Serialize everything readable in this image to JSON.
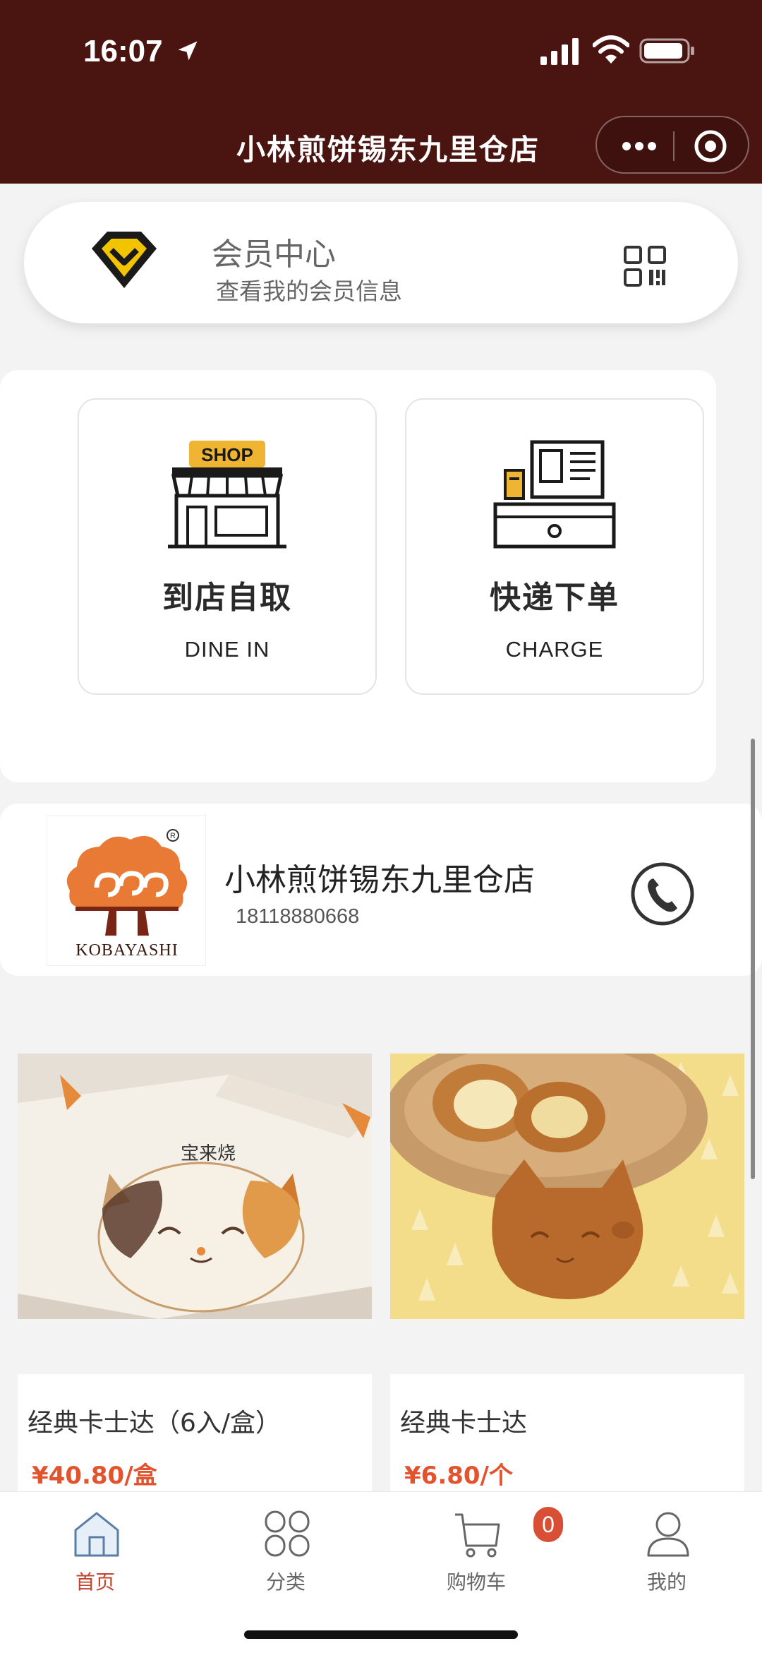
{
  "status_bar": {
    "time": "16:07"
  },
  "nav": {
    "title": "小林煎饼锡东九里仓店"
  },
  "member": {
    "title": "会员中心",
    "subtitle": "查看我的会员信息"
  },
  "services": [
    {
      "title": "到店自取",
      "subtitle": "DINE IN",
      "sign": "SHOP"
    },
    {
      "title": "快递下单",
      "subtitle": "CHARGE"
    }
  ],
  "store": {
    "name": "小林煎饼锡东九里仓店",
    "phone": "18118880668",
    "logo_text": "KOBAYASHI"
  },
  "products": [
    {
      "name": "经典卡士达（6入/盒）",
      "price": "¥40.80/盒",
      "box_text": "宝来烧"
    },
    {
      "name": "经典卡士达",
      "price": "¥6.80/个"
    }
  ],
  "tabbar": {
    "items": [
      {
        "label": "首页",
        "icon": "home-icon"
      },
      {
        "label": "分类",
        "icon": "category-icon"
      },
      {
        "label": "购物车",
        "icon": "cart-icon"
      },
      {
        "label": "我的",
        "icon": "user-icon"
      }
    ],
    "cart_count": "0"
  },
  "colors": {
    "header": "#4a1411",
    "accent": "#c2442e",
    "price": "#e2532e",
    "badge": "#d84f36"
  }
}
